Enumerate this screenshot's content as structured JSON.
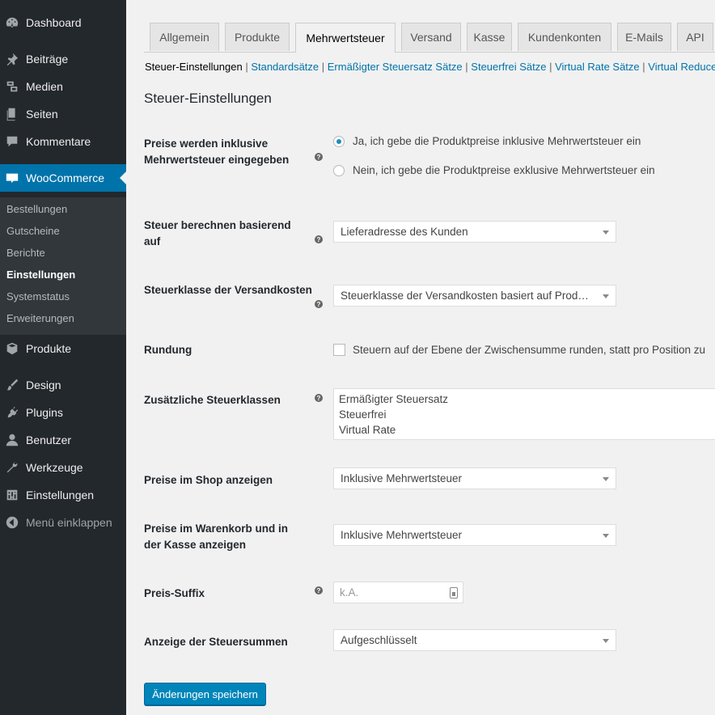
{
  "sidebar": {
    "dashboard": "Dashboard",
    "beitraege": "Beiträge",
    "medien": "Medien",
    "seiten": "Seiten",
    "kommentare": "Kommentare",
    "woocommerce": "WooCommerce",
    "woo_sub": [
      "Bestellungen",
      "Gutscheine",
      "Berichte",
      "Einstellungen",
      "Systemstatus",
      "Erweiterungen"
    ],
    "produkte": "Produkte",
    "design": "Design",
    "plugins": "Plugins",
    "benutzer": "Benutzer",
    "werkzeuge": "Werkzeuge",
    "einstellungen": "Einstellungen",
    "collapse": "Menü einklappen"
  },
  "tabs": [
    "Allgemein",
    "Produkte",
    "Mehrwertsteuer",
    "Versand",
    "Kasse",
    "Kundenkonten",
    "E-Mails",
    "API"
  ],
  "subsub": [
    "Steuer-Einstellungen",
    "Standardsätze",
    "Ermäßigter Steuersatz Sätze",
    "Steuerfrei Sätze",
    "Virtual Rate Sätze",
    "Virtual Reduced"
  ],
  "section_title": "Steuer-Einstellungen",
  "fields": {
    "prices_incl_label": "Preise werden inklusive Mehrwertsteuer eingegeben",
    "prices_incl_yes": "Ja, ich gebe die Produktpreise inklusive Mehrwertsteuer ein",
    "prices_incl_no": "Nein, ich gebe die Produktpreise exklusive Mehrwertsteuer ein",
    "calc_based_label": "Steuer berechnen basierend auf",
    "calc_based_value": "Lieferadresse des Kunden",
    "shipping_class_label": "Steuerklasse der Versandkosten",
    "shipping_class_value": "Steuerklasse der Versandkosten basiert auf Produkten im Warenkorb",
    "rounding_label": "Rundung",
    "rounding_text": "Steuern auf der Ebene der Zwischensumme runden, statt pro Position zu",
    "classes_label": "Zusätzliche Steuerklassen",
    "classes_values": [
      "Ermäßigter Steuersatz",
      "Steuerfrei",
      "Virtual Rate"
    ],
    "shop_display_label": "Preise im Shop anzeigen",
    "shop_display_value": "Inklusive Mehrwertsteuer",
    "cart_display_label": "Preise im Warenkorb und in der Kasse anzeigen",
    "cart_display_value": "Inklusive Mehrwertsteuer",
    "suffix_label": "Preis-Suffix",
    "suffix_placeholder": "k.A.",
    "totals_label": "Anzeige der Steuersummen",
    "totals_value": "Aufgeschlüsselt"
  },
  "help_glyph": "?",
  "save_label": "Änderungen speichern"
}
